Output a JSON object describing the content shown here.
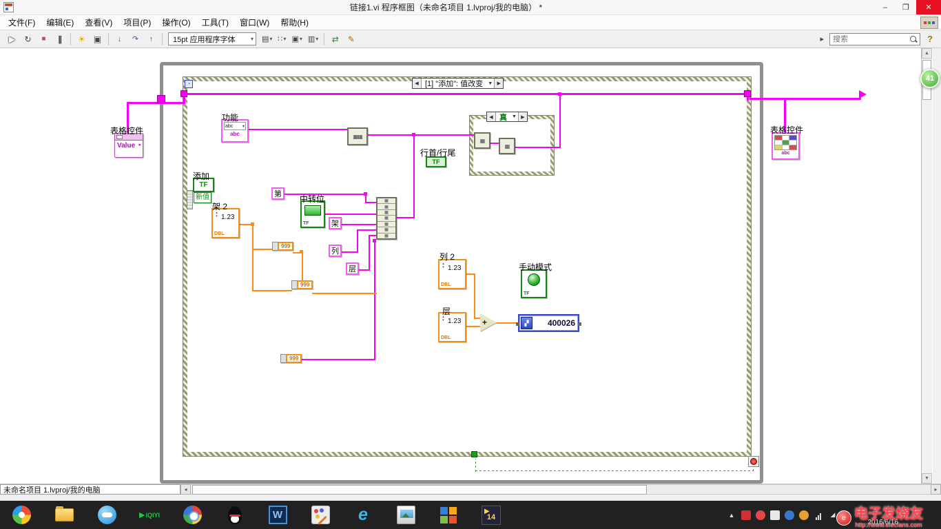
{
  "window": {
    "title": "链接1.vi 程序框图（未命名项目 1.lvproj/我的电脑） *",
    "minimize": "–",
    "maximize": "❐",
    "close": "✕"
  },
  "menu": {
    "items": [
      "文件(F)",
      "编辑(E)",
      "查看(V)",
      "项目(P)",
      "操作(O)",
      "工具(T)",
      "窗口(W)",
      "帮助(H)"
    ]
  },
  "toolbar": {
    "font": "15pt 应用程序字体",
    "search_placeholder": "搜索",
    "help": "?",
    "buttons": [
      {
        "name": "run",
        "glyph": "▶"
      },
      {
        "name": "run-continuous",
        "glyph": "↻"
      },
      {
        "name": "abort-execution",
        "glyph": "■"
      },
      {
        "name": "pause",
        "glyph": "∥"
      },
      {
        "name": "highlight-execution",
        "glyph": "☀"
      },
      {
        "name": "retain-wire-values",
        "glyph": "▣"
      },
      {
        "name": "step-into",
        "glyph": "↓"
      },
      {
        "name": "step-over",
        "glyph": "↷"
      },
      {
        "name": "step-out",
        "glyph": "↑"
      }
    ],
    "dropdowns": [
      {
        "name": "align-objects",
        "glyph": "▤"
      },
      {
        "name": "distribute-objects",
        "glyph": "∷"
      },
      {
        "name": "resize-objects",
        "glyph": "▣"
      },
      {
        "name": "reorder-objects",
        "glyph": "▥"
      }
    ],
    "extra": [
      {
        "name": "clean-up-diagram",
        "glyph": "⇄"
      },
      {
        "name": "edit-tool",
        "glyph": "✎"
      }
    ]
  },
  "glyphs": {
    "left": "◀",
    "right": "▶",
    "up": "▲",
    "down": "▼",
    "small_left": "◂",
    "small_right": "▸",
    "dd": "▾",
    "spin_up": "▴",
    "spin_down": "▾",
    "grid": "▦",
    "icon_glyph": "▞",
    "hourglass": "◔"
  },
  "diagram": {
    "event_case_label": "[1] \"添加\": 值改变",
    "case_selector": "真",
    "left_table_label": "表格控件",
    "property_value": "Value",
    "right_table_label": "表格控件",
    "table_abc": "abc",
    "function_label": "功能",
    "abc": "abc",
    "add_label": "添加",
    "tf": "TF",
    "new_value_label": "新值",
    "rack2_label": "架 2",
    "numeric_value": "1.23",
    "dbl": "DBL",
    "first_char": "第",
    "transfer_label": "中转位",
    "rack_char": "架",
    "col_char": "列",
    "layer_char": "层",
    "head_tail_label": "行首/行尾",
    "col2_label": "列 2",
    "manual_mode_label": "手动模式",
    "layer_label": "层",
    "array_value": "999",
    "result_value": "400026",
    "plus": "+"
  },
  "statusbar": {
    "text": "未命名项目 1.lvproj/我的电脑"
  },
  "taskbar": {
    "icons": [
      "start",
      "file-explorer",
      "cloud-app",
      "iqiyi",
      "browser",
      "qq",
      "word",
      "paint-tool",
      "internet-explorer",
      "snipping-tool",
      "grid-app",
      "labview-2014"
    ],
    "iqiyi_text": "iQIYI",
    "word_letter": "W",
    "ie_letter": "e",
    "labview_badge": "14"
  },
  "tray": {
    "date": "2016/6/16"
  },
  "watermark": {
    "title": "电子发烧友",
    "url": "http://www.elecfans.com"
  },
  "float_ball": {
    "count": "41"
  }
}
